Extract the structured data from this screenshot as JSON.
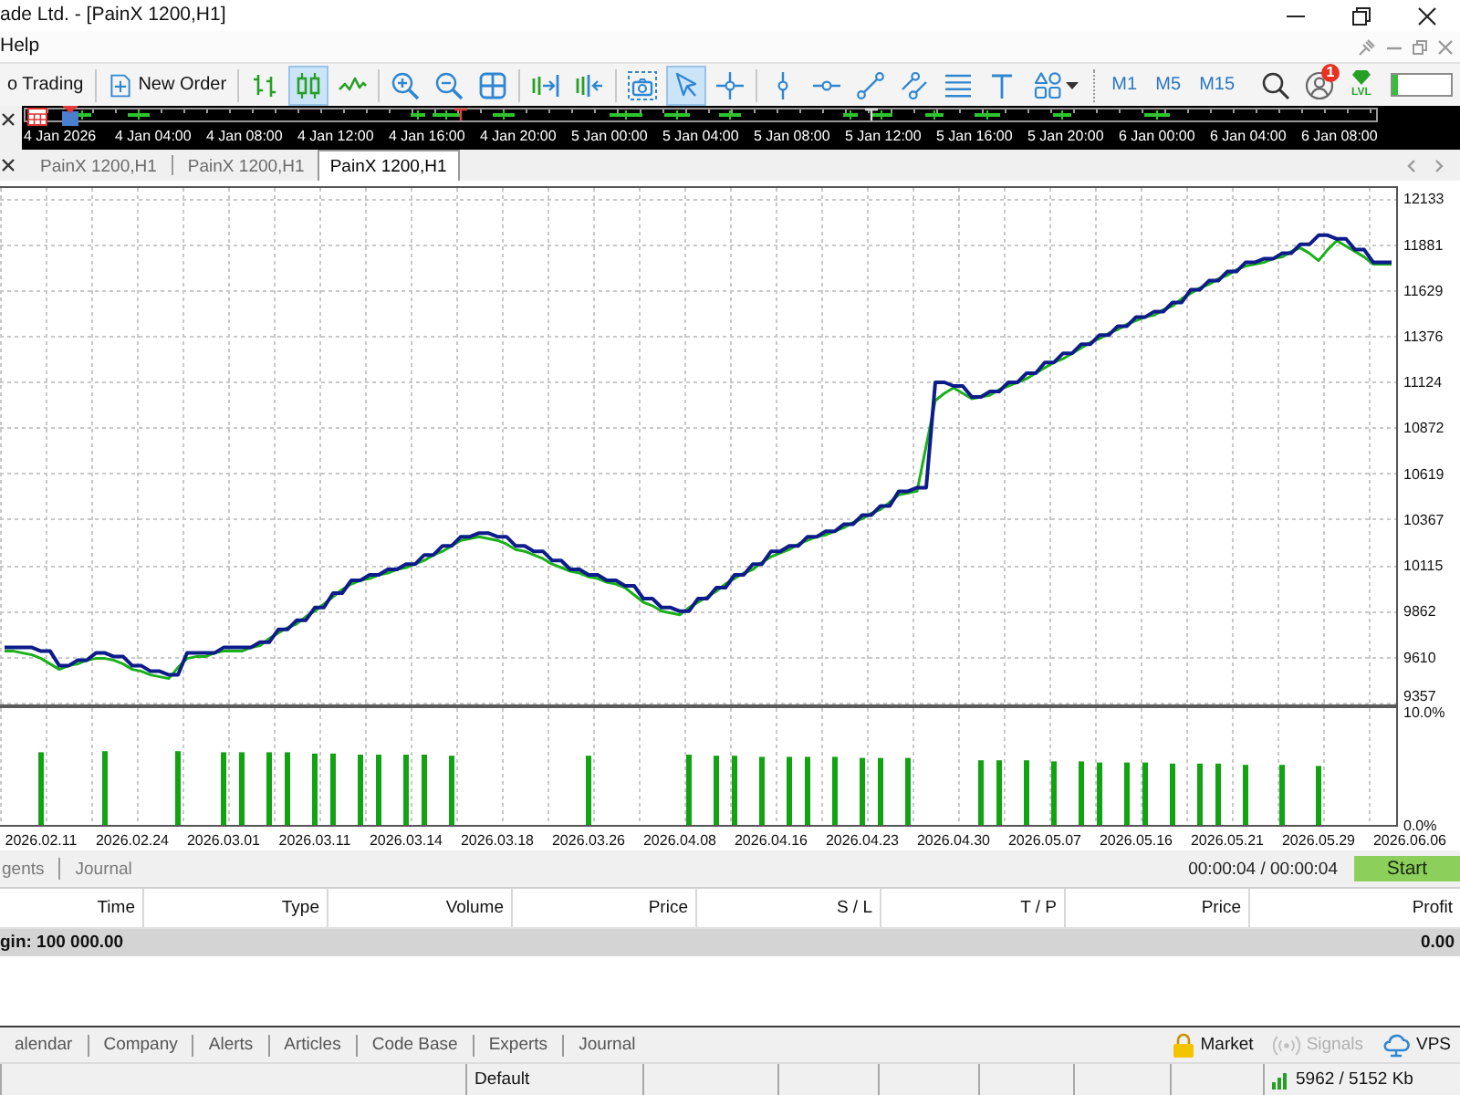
{
  "window": {
    "title": "ade Ltd. - [PainX 1200,H1]"
  },
  "menu": [
    {
      "label": "Help"
    }
  ],
  "toolbar": {
    "buttons": [
      {
        "label": "o Trading"
      },
      {
        "label": "New Order"
      }
    ],
    "chart_types": [
      {
        "selected": false
      },
      {
        "selected": true
      },
      {
        "selected": false
      }
    ],
    "object_tools": [
      {
        "selected": true
      },
      {
        "selected": false
      },
      {
        "selected": false
      },
      {
        "selected": false
      },
      {
        "selected": false
      },
      {
        "selected": false
      },
      {
        "selected": false
      },
      {
        "selected": false
      },
      {
        "selected": false
      }
    ],
    "timeframes": [
      {
        "label": "M1",
        "selected": false
      },
      {
        "label": "M5",
        "selected": false
      },
      {
        "label": "M15",
        "selected": false
      }
    ],
    "notification_count": "1",
    "level_label": "LVL",
    "progress": {
      "level": 0.1
    }
  },
  "timeline": {
    "labels": [
      "4 Jan 2026",
      "4 Jan 04:00",
      "4 Jan 08:00",
      "4 Jan 12:00",
      "4 Jan 16:00",
      "4 Jan 20:00",
      "5 Jan 00:00",
      "5 Jan 04:00",
      "5 Jan 08:00",
      "5 Jan 12:00",
      "5 Jan 16:00",
      "5 Jan 20:00",
      "6 Jan 00:00",
      "6 Jan 04:00",
      "6 Jan 08:00"
    ]
  },
  "chart_tabs": [
    {
      "label": "PainX 1200,H1",
      "selected": false
    },
    {
      "label": "PainX 1200,H1",
      "selected": false
    },
    {
      "label": "PainX 1200,H1",
      "selected": true
    }
  ],
  "chart": {
    "panes": [
      {
        "chart_data": {
          "type": "line",
          "grid": true,
          "categories": [
            null,
            null,
            null,
            null,
            null,
            null,
            null,
            null,
            null,
            null,
            null,
            null,
            null,
            null,
            null,
            null,
            null,
            null,
            null,
            null,
            null,
            null,
            null,
            null,
            null,
            null,
            null,
            null,
            null,
            null,
            null,
            null,
            null,
            null,
            null,
            null,
            null,
            null,
            null,
            null,
            null,
            null,
            null,
            null,
            null,
            null,
            null,
            null,
            null,
            null,
            null,
            null,
            null,
            null,
            null,
            null,
            null,
            null,
            null,
            null,
            null,
            null,
            null,
            null,
            null,
            null,
            null,
            null,
            null,
            null,
            null,
            null,
            null,
            null,
            null,
            null,
            null,
            null,
            null,
            null,
            null,
            null,
            null,
            null,
            null,
            null,
            null,
            null,
            null,
            null,
            null,
            null,
            null,
            null,
            null,
            null,
            null,
            null,
            null,
            null,
            null,
            null,
            null,
            null,
            null,
            null,
            null,
            null,
            null,
            null,
            null,
            null,
            null,
            null,
            null,
            null,
            null,
            null,
            null,
            null,
            null,
            null,
            null,
            null,
            null,
            null,
            null,
            null,
            null,
            null,
            null,
            null,
            null,
            null,
            null,
            null,
            null,
            null,
            null,
            null,
            null,
            null,
            null,
            null,
            null,
            null,
            null,
            null,
            null,
            null,
            null,
            null,
            null,
            null,
            null
          ],
          "series": [
            {
              "color": "#0d1c8a",
              "values": [
                9660,
                9660,
                9660,
                9660,
                9640,
                9640,
                9560,
                9560,
                9590,
                9590,
                9630,
                9630,
                9610,
                9610,
                9560,
                9560,
                9530,
                9530,
                9510,
                9510,
                9630,
                9630,
                9630,
                9630,
                9660,
                9660,
                9660,
                9660,
                9690,
                9690,
                9760,
                9760,
                9810,
                9810,
                9880,
                9880,
                9960,
                9960,
                10030,
                10030,
                10060,
                10060,
                10090,
                10090,
                10120,
                10120,
                10170,
                10170,
                10220,
                10220,
                10270,
                10270,
                10290,
                10290,
                10270,
                10270,
                10220,
                10220,
                10190,
                10190,
                10140,
                10140,
                10090,
                10090,
                10060,
                10060,
                10030,
                10030,
                10000,
                10000,
                9930,
                9930,
                9880,
                9880,
                9860,
                9860,
                9930,
                9930,
                9990,
                9990,
                10060,
                10060,
                10120,
                10120,
                10190,
                10190,
                10220,
                10220,
                10270,
                10270,
                10300,
                10300,
                10340,
                10340,
                10390,
                10390,
                10440,
                10440,
                10520,
                10520,
                10540,
                10540,
                11120,
                11120,
                11100,
                11100,
                11040,
                11040,
                11070,
                11070,
                11120,
                11120,
                11170,
                11170,
                11230,
                11230,
                11280,
                11280,
                11330,
                11330,
                11380,
                11380,
                11430,
                11430,
                11480,
                11480,
                11510,
                11510,
                11560,
                11560,
                11630,
                11630,
                11680,
                11680,
                11730,
                11730,
                11780,
                11780,
                11800,
                11800,
                11830,
                11830,
                11880,
                11880,
                11930,
                11930,
                11910,
                11910,
                11850,
                11850,
                11780,
                11780,
                11780,
                null,
                null
              ]
            },
            {
              "color": "#19b019",
              "values": [
                9640,
                9640,
                9630,
                9620,
                9600,
                9570,
                9540,
                9560,
                9570,
                9590,
                9600,
                9600,
                9590,
                9570,
                9540,
                9530,
                9510,
                9500,
                9490,
                9550,
                9600,
                9610,
                9610,
                9630,
                9640,
                9640,
                9640,
                9660,
                9670,
                9710,
                9740,
                9770,
                9790,
                9830,
                9860,
                9900,
                9940,
                9980,
                10010,
                10030,
                10040,
                10060,
                10070,
                10090,
                10100,
                10120,
                10140,
                10170,
                10190,
                10220,
                10250,
                10260,
                10270,
                10260,
                10250,
                10230,
                10200,
                10190,
                10170,
                10150,
                10120,
                10100,
                10080,
                10070,
                10050,
                10040,
                10020,
                10010,
                9990,
                9950,
                9910,
                9890,
                9860,
                9850,
                9840,
                9880,
                9910,
                9940,
                9970,
                10010,
                10040,
                10070,
                10090,
                10130,
                10160,
                10180,
                10200,
                10230,
                10250,
                10270,
                10280,
                10300,
                10320,
                10350,
                10370,
                10400,
                10420,
                10460,
                10500,
                10510,
                10520,
                10770,
                11020,
                11060,
                11090,
                11060,
                11030,
                11040,
                11050,
                11080,
                11100,
                11120,
                11140,
                11170,
                11200,
                11230,
                11250,
                11280,
                11310,
                11340,
                11360,
                11390,
                11410,
                11440,
                11460,
                11480,
                11490,
                11520,
                11540,
                11580,
                11610,
                11640,
                11660,
                11690,
                11710,
                11740,
                11760,
                11770,
                11780,
                11800,
                11810,
                11840,
                11860,
                11830,
                11790,
                11850,
                11900,
                11870,
                11840,
                11810,
                11770,
                11770,
                11770,
                null,
                null
              ]
            }
          ],
          "ylim": [
            9357,
            12190
          ],
          "yticks": [
            9357,
            9610,
            9862,
            10115,
            10367,
            10619,
            10872,
            11124,
            11376,
            11629,
            11881,
            12133
          ]
        }
      },
      {
        "chart_data": {
          "type": "bar",
          "grid": true,
          "categories": [
            null,
            null,
            null,
            null,
            "2026.02.11",
            null,
            null,
            null,
            null,
            null,
            null,
            null,
            null,
            null,
            "2026.02.24",
            null,
            null,
            null,
            null,
            null,
            null,
            null,
            null,
            null,
            "2026.03.01",
            null,
            null,
            null,
            null,
            null,
            null,
            null,
            null,
            null,
            "2026.03.11",
            null,
            null,
            null,
            null,
            null,
            null,
            null,
            null,
            null,
            "2026.03.14",
            null,
            null,
            null,
            null,
            null,
            null,
            null,
            null,
            null,
            "2026.03.18",
            null,
            null,
            null,
            null,
            null,
            null,
            null,
            null,
            null,
            "2026.03.26",
            null,
            null,
            null,
            null,
            null,
            null,
            null,
            null,
            null,
            "2026.04.08",
            null,
            null,
            null,
            null,
            null,
            null,
            null,
            null,
            null,
            "2026.04.16",
            null,
            null,
            null,
            null,
            null,
            null,
            null,
            null,
            null,
            "2026.04.23",
            null,
            null,
            null,
            null,
            null,
            null,
            null,
            null,
            null,
            "2026.04.30",
            null,
            null,
            null,
            null,
            null,
            null,
            null,
            null,
            null,
            "2026.05.07",
            null,
            null,
            null,
            null,
            null,
            null,
            null,
            null,
            null,
            "2026.05.16",
            null,
            null,
            null,
            null,
            null,
            null,
            null,
            null,
            null,
            "2026.05.21",
            null,
            null,
            null,
            null,
            null,
            null,
            null,
            null,
            null,
            "2026.05.29",
            null,
            null,
            null,
            null,
            null,
            null,
            null,
            null,
            null,
            "2026.06.06"
          ],
          "series": [
            {
              "color": "#12a312",
              "values": [
                null,
                null,
                null,
                null,
                6.4,
                null,
                null,
                null,
                null,
                null,
                null,
                6.5,
                null,
                null,
                null,
                null,
                null,
                null,
                null,
                6.5,
                null,
                null,
                null,
                null,
                6.4,
                null,
                6.4,
                null,
                null,
                6.4,
                null,
                6.4,
                null,
                null,
                6.3,
                null,
                6.3,
                null,
                null,
                6.2,
                null,
                6.2,
                null,
                null,
                6.2,
                null,
                6.2,
                null,
                null,
                6.1,
                null,
                null,
                null,
                null,
                null,
                null,
                null,
                null,
                null,
                null,
                null,
                null,
                null,
                null,
                6.1,
                null,
                null,
                null,
                null,
                null,
                null,
                null,
                null,
                null,
                null,
                6.2,
                null,
                null,
                6.1,
                null,
                6.1,
                null,
                null,
                6.0,
                null,
                null,
                6.0,
                null,
                6.0,
                null,
                null,
                6.0,
                null,
                null,
                5.9,
                null,
                5.9,
                null,
                null,
                5.9,
                null,
                null,
                null,
                null,
                null,
                null,
                null,
                5.7,
                null,
                5.7,
                null,
                null,
                5.7,
                null,
                null,
                5.6,
                null,
                null,
                5.6,
                null,
                5.5,
                null,
                null,
                5.5,
                null,
                5.5,
                null,
                null,
                5.4,
                null,
                null,
                5.4,
                null,
                5.4,
                null,
                null,
                5.3,
                null,
                null,
                null,
                5.3,
                null,
                null,
                null,
                5.2,
                null,
                null,
                null,
                null,
                null,
                null,
                null,
                null,
                null,
                null
              ]
            }
          ],
          "ylim": [
            0,
            10.3
          ],
          "yticks": [
            {
              "value": 0,
              "label": "0.0%"
            },
            {
              "value": 10,
              "label": "10.0%"
            }
          ]
        }
      }
    ]
  },
  "tester": {
    "tabs": [
      {
        "label": "gents",
        "selected": false
      },
      {
        "label": "Journal",
        "selected": false
      }
    ],
    "timer": "00:00:04 / 00:00:04",
    "start_button": "Start",
    "columns": [
      "Time",
      "Type",
      "Volume",
      "Price",
      "S / L",
      "T / P",
      "Price",
      "Profit"
    ],
    "summary_row": {
      "text": "gin: 100 000.00",
      "profit": "0.00"
    }
  },
  "toolbox_tabs": [
    {
      "label": "alendar",
      "selected": false
    },
    {
      "label": "Company",
      "selected": false
    },
    {
      "label": "Alerts",
      "selected": false
    },
    {
      "label": "Articles",
      "selected": false
    },
    {
      "label": "Code Base",
      "selected": false
    },
    {
      "label": "Experts",
      "selected": false
    },
    {
      "label": "Journal",
      "selected": false
    }
  ],
  "services": [
    {
      "kind": "market",
      "label": "Market",
      "disabled": false
    },
    {
      "kind": "signals",
      "label": "Signals",
      "disabled": true
    },
    {
      "kind": "vps",
      "label": "VPS",
      "disabled": false
    }
  ],
  "status_bar": {
    "profile": "Default",
    "traffic": "5962 / 5152 Kb"
  }
}
